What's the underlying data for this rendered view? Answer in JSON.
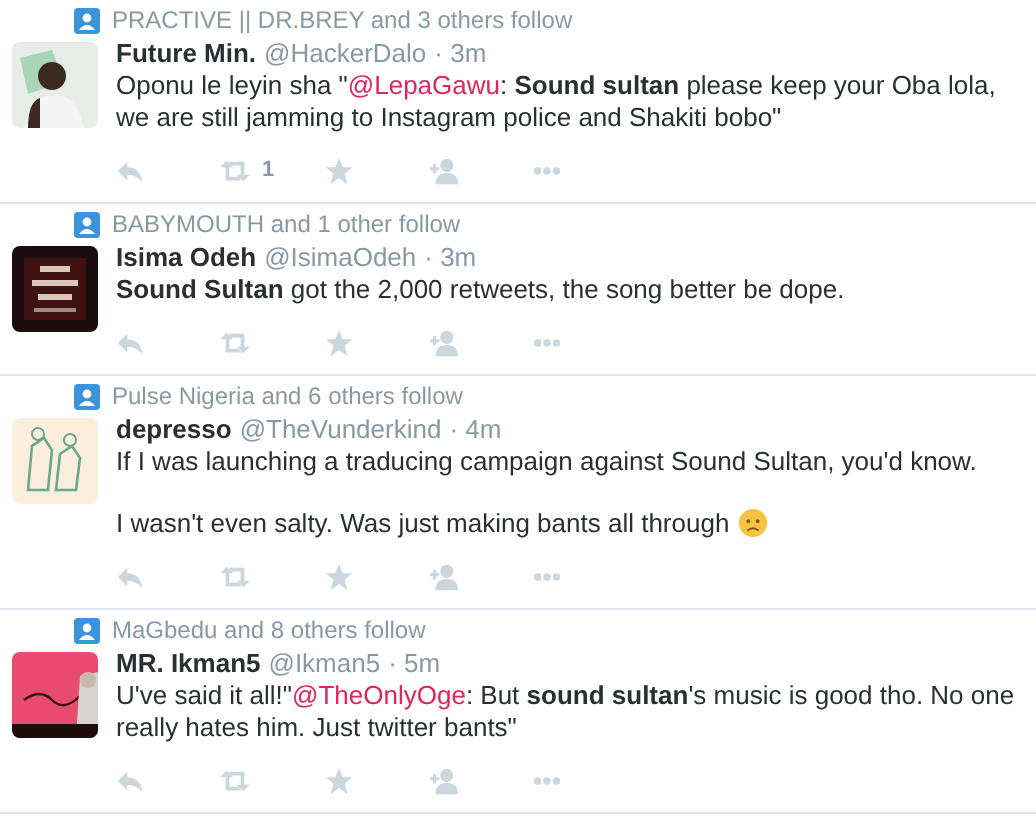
{
  "tweets": [
    {
      "followed_by": "PRACTIVE || DR.BREY and 3 others follow",
      "name": "Future Min.",
      "handle": "@HackerDalo",
      "time": "· 3m",
      "avatar": {
        "kind": "picture"
      },
      "paragraphs": [
        [
          {
            "kind": "text",
            "text": "Oponu le leyin sha \""
          },
          {
            "kind": "mention",
            "text": "@LepaGawu"
          },
          {
            "kind": "text",
            "text": ": **Sound sultan** please keep your Oba lola, we are still jamming to Instagram police and Shakiti bobo\""
          }
        ]
      ],
      "retweet_count": "1"
    },
    {
      "followed_by": "BABYMOUTH and 1 other follow",
      "name": "Isima Odeh",
      "handle": "@IsimaOdeh",
      "time": "· 3m",
      "avatar": {
        "kind": "picture"
      },
      "paragraphs": [
        [
          {
            "kind": "text",
            "text": "**Sound Sultan** got the 2,000 retweets, the song better be dope."
          }
        ]
      ]
    },
    {
      "followed_by": "Pulse Nigeria and 6 others follow",
      "name": "depresso",
      "handle": "@TheVunderkind",
      "time": "· 4m",
      "avatar": {
        "kind": "picture"
      },
      "paragraphs": [
        [
          {
            "kind": "text",
            "text": "If I was launching a traducing campaign against Sound Sultan, you'd know."
          }
        ],
        [
          {
            "kind": "text",
            "text": "I wasn't even salty. Was just making bants all through"
          },
          {
            "kind": "emoji"
          }
        ]
      ]
    },
    {
      "followed_by": "MaGbedu and 8 others follow",
      "name": "MR. Ikman5",
      "handle": "@Ikman5",
      "time": "· 5m",
      "avatar": {
        "kind": "picture"
      },
      "paragraphs": [
        [
          {
            "kind": "text",
            "text": "U've said it all!\""
          },
          {
            "kind": "mention",
            "text": "@TheOnlyOge"
          },
          {
            "kind": "text",
            "text": ": But **sound sultan**'s music is good tho. No one really hates him. Just twitter bants\""
          }
        ]
      ]
    }
  ]
}
